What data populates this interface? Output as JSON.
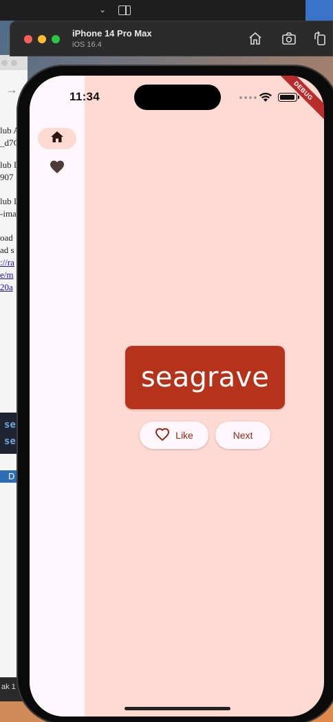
{
  "simulator": {
    "device_name": "iPhone 14 Pro Max",
    "os_version": "iOS 16.4",
    "toolbar_icons": [
      "home-icon",
      "screenshot-icon",
      "rotate-icon"
    ]
  },
  "status_bar": {
    "time": "11:34"
  },
  "debug_banner": "DEBUG",
  "navigation": {
    "items": [
      {
        "icon": "home-icon",
        "selected": true
      },
      {
        "icon": "heart-icon",
        "selected": false
      }
    ]
  },
  "main": {
    "word": "seagrave",
    "like_label": "Like",
    "next_label": "Next"
  },
  "colors": {
    "background": "#ffdad2",
    "rail": "#fff7fb",
    "card": "#b5331a",
    "button_text": "#8c2a14"
  },
  "background_window": {
    "lines": [
      "lub A",
      "_d7C",
      "lub I",
      "907",
      "lub I",
      "-ima",
      "oad",
      "ad s",
      "://ra",
      "e/m",
      "20a",
      "se",
      "se",
      "D",
      "ak  1"
    ]
  }
}
